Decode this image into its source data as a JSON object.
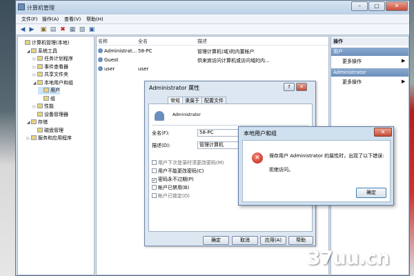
{
  "window": {
    "title": "计算机管理",
    "min": "–",
    "max": "□",
    "close": "✕"
  },
  "menu": [
    "文件(F)",
    "操作(A)",
    "查看(V)",
    "帮助(H)"
  ],
  "tree": [
    {
      "label": "计算机管理(本地)",
      "indent": 0,
      "toggle": ""
    },
    {
      "label": "系统工具",
      "indent": 1,
      "toggle": "◢"
    },
    {
      "label": "任务计划程序",
      "indent": 2,
      "toggle": "▷"
    },
    {
      "label": "事件查看器",
      "indent": 2,
      "toggle": "▷"
    },
    {
      "label": "共享文件夹",
      "indent": 2,
      "toggle": "▷"
    },
    {
      "label": "本地用户和组",
      "indent": 2,
      "toggle": "◢"
    },
    {
      "label": "用户",
      "indent": 3,
      "toggle": "",
      "selected": true
    },
    {
      "label": "组",
      "indent": 3,
      "toggle": ""
    },
    {
      "label": "性能",
      "indent": 2,
      "toggle": "▷"
    },
    {
      "label": "设备管理器",
      "indent": 2,
      "toggle": ""
    },
    {
      "label": "存储",
      "indent": 1,
      "toggle": "◢"
    },
    {
      "label": "磁盘管理",
      "indent": 2,
      "toggle": ""
    },
    {
      "label": "服务和应用程序",
      "indent": 1,
      "toggle": "▷"
    }
  ],
  "list": {
    "columns": [
      "名称",
      "全名",
      "描述"
    ],
    "rows": [
      {
        "name": "Administrat...",
        "fullname": "58-PC",
        "desc": "管理计算机(域)的内置帐户"
      },
      {
        "name": "Guest",
        "fullname": "",
        "desc": "供来宾访问计算机或访问域的内..."
      },
      {
        "name": "user",
        "fullname": "user",
        "desc": ""
      }
    ]
  },
  "actions": {
    "header": "操作",
    "sections": [
      {
        "title": "用户",
        "item": "更多操作"
      },
      {
        "title": "Administrator",
        "item": "更多操作"
      }
    ],
    "arrow": "▶"
  },
  "props": {
    "title": "Administrator 属性",
    "help": "?",
    "close": "✕",
    "tabs": [
      "常规",
      "隶属于",
      "配置文件"
    ],
    "username": "Administrator",
    "fullname_label": "全名(F):",
    "fullname_value": "58-PC",
    "desc_label": "描述(D):",
    "desc_value": "管理计算机",
    "checkboxes": [
      {
        "label": "用户下次登录时须更改密码(M)",
        "checked": false,
        "enabled": false
      },
      {
        "label": "用户不能更改密码(C)",
        "checked": false,
        "enabled": true
      },
      {
        "label": "密码永不过期(P)",
        "checked": true,
        "enabled": true
      },
      {
        "label": "帐户已禁用(B)",
        "checked": false,
        "enabled": true
      },
      {
        "label": "帐户已锁定(O)",
        "checked": false,
        "enabled": false
      }
    ],
    "buttons": {
      "ok": "确定",
      "cancel": "取消",
      "apply": "应用(A)",
      "help": "帮助"
    }
  },
  "error": {
    "title": "本地用户和组",
    "close": "✕",
    "icon": "✕",
    "message": "保存用户 Administrator 的属性时，出现了以下错误:",
    "detail": "拒绝访问。",
    "ok": "确定"
  },
  "watermark": "37uu.cn"
}
